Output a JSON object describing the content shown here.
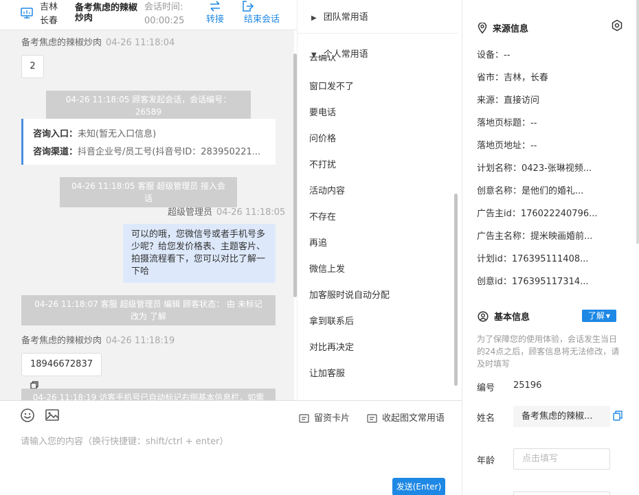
{
  "header": {
    "location_province": "吉林",
    "location_city": "长春",
    "visitor_name": "备考焦虑的辣椒炒肉",
    "session_time_label": "会话时间:",
    "session_time": "00:00:25",
    "transfer_label": "转接",
    "end_label": "结束会话"
  },
  "messages": {
    "m1_sender": "备考焦虑的辣椒炒肉",
    "m1_time": "04-26 11:18:04",
    "m1_text": "2",
    "sys1": "04-26 11:18:05 顾客发起会话，会话编号：26589",
    "card_entry_label": "咨询入口：",
    "card_entry_value": "未知(暂无入口信息)",
    "card_channel_label": "咨询渠道：",
    "card_channel_value": "抖音企业号/员工号(抖音号ID：283950221...",
    "sys2": "04-26 11:18:05 客服 超级管理员 接入会话",
    "m2_sender": "超级管理员",
    "m2_time": "04-26 11:18:05",
    "m2_text": "可以的哦，您微信号或者手机号多少呢？给您发价格表、主题客片、拍摄流程看下，您可以对比了解一下哈",
    "sys3": "04-26 11:18:07 客服 超级管理员 编辑 顾客状态： 由 未标记 改为 了解",
    "m3_sender": "备考焦虑的辣椒炒肉",
    "m3_time": "04-26 11:18:19",
    "m3_text": "18946672837",
    "sys4": "04-26 11:18:19 访客手机号已自动标记右侧基本信息栏，如需"
  },
  "input": {
    "lead_card": "留资卡片",
    "collapse_phrases": "收起图文常用语",
    "placeholder": "请输入您的内容（换行快捷键：shift/ctrl + enter）",
    "send": "发送(Enter)"
  },
  "phrases": {
    "team_group": "团队常用语",
    "personal_group": "个人常用语",
    "cut_item": "去确认",
    "items": [
      "窗口发不了",
      "要电话",
      "问价格",
      "不打扰",
      "活动内容",
      "不存在",
      "再追",
      "微信上发",
      "加客服时说自动分配",
      "拿到联系后",
      "对比再决定",
      "让加客服"
    ]
  },
  "source": {
    "title": "来源信息",
    "device": "设备：--",
    "province_city": "省市：吉林，长春",
    "origin": "来源：直接访问",
    "landing_title": "落地页标题：--",
    "landing_url": "落地页地址：--",
    "plan_name": "计划名称：0423-张琳视频...",
    "creative_name": "创意名称：是他们的婚礼...",
    "advertiser_id": "广告主id：176022240796...",
    "advertiser_name": "广告主名称：提米映画婚前...",
    "plan_id": "计划id：176395111408...",
    "creative_id": "创意id：176395117314..."
  },
  "basic": {
    "title": "基本信息",
    "status_tag": "了解",
    "notice": "为了保障您的使用体验，会话发生当日的24点之后，顾客信息将无法修改，请及时填写",
    "id_label": "编号",
    "id_value": "25196",
    "name_label": "姓名",
    "name_value": "备考焦虑的辣椒...",
    "age_label": "年龄",
    "age_placeholder": "点击填写"
  },
  "colors": {
    "accent": "#1e88e5",
    "bubble_agent": "#dde9fb",
    "system_msg": "#cfcfcf",
    "chat_bg": "#f2f2f2"
  }
}
